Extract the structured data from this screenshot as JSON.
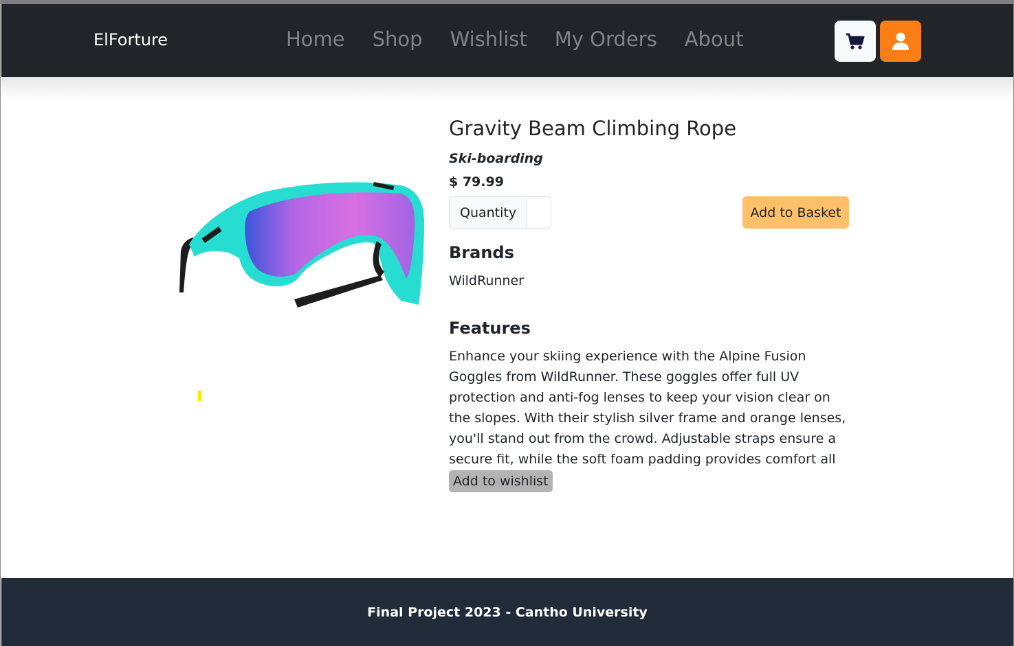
{
  "navbar": {
    "brand": "ElForture",
    "links": [
      "Home",
      "Shop",
      "Wishlist",
      "My Orders",
      "About"
    ],
    "cart_icon": "cart-icon",
    "user_icon": "user-icon",
    "accent_color": "#fd7e14"
  },
  "product": {
    "name": "Gravity Beam Climbing Rope",
    "category": "Ski-boarding",
    "price": "$ 79.99",
    "quantity_label": "Quantity",
    "quantity_value": "",
    "add_to_basket": "Add to Basket",
    "brands_heading": "Brands",
    "brand": "WildRunner",
    "features_heading": "Features",
    "features": "Enhance your skiing experience with the Alpine Fusion Goggles from WildRunner. These goggles offer full UV protection and anti-fog lenses to keep your vision clear on the slopes. With their stylish silver frame and orange lenses, you'll stand out from the crowd. Adjustable straps ensure a secure fit, while the soft foam padding provides comfort all day long.",
    "add_to_wishlist": "Add to wishlist"
  },
  "footer": {
    "text": "Final Project 2023 - Cantho University"
  }
}
